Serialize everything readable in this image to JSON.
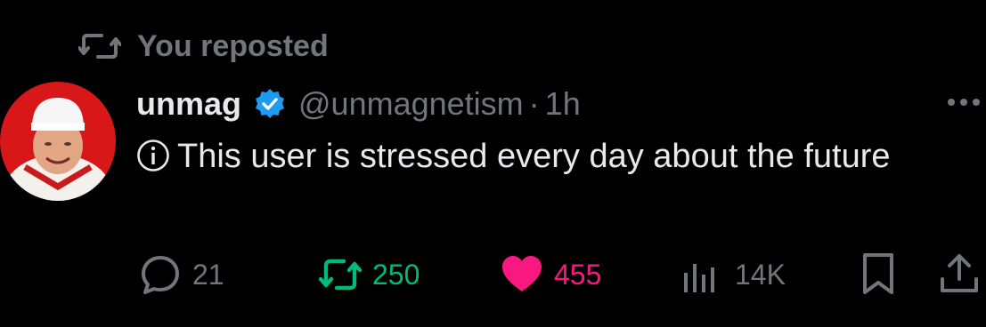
{
  "repost": {
    "text": "You reposted",
    "icon": "retweet-icon"
  },
  "user": {
    "name": "unmag",
    "handle": "@unmagnetism",
    "time": "1h",
    "verified": true
  },
  "tweet": {
    "text": "This user is stressed every day about the future",
    "prefix_icon": "info-icon"
  },
  "actions": {
    "replies": "21",
    "reposts": "250",
    "likes": "455",
    "views": "14K"
  },
  "colors": {
    "muted": "#71767b",
    "verified": "#1d9bf0",
    "repost_active": "#00ba7c",
    "like_active": "#f91880"
  }
}
